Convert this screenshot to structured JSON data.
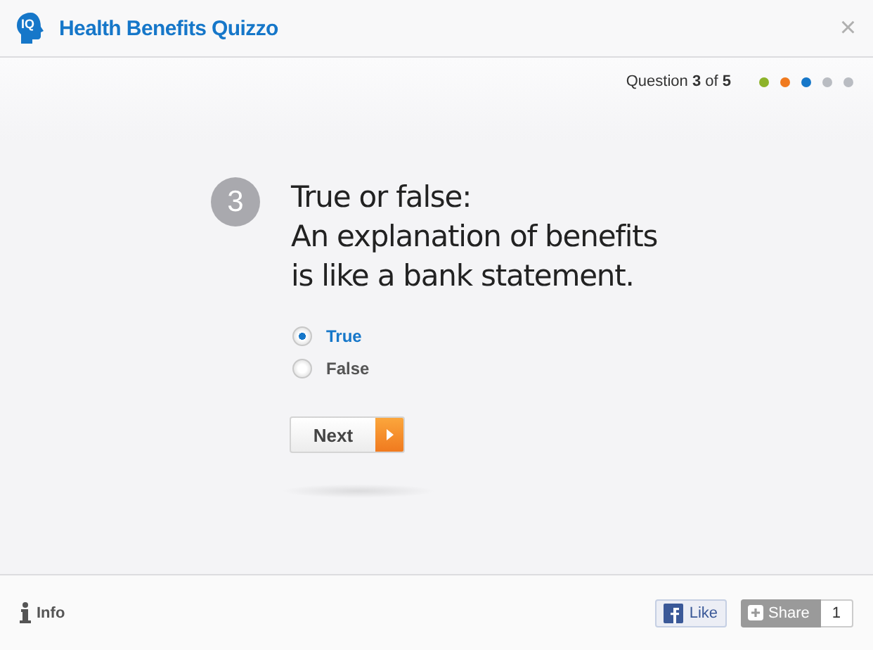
{
  "header": {
    "logo_text": "IQ",
    "title": "Health Benefits Quizzo",
    "close": "×"
  },
  "progress": {
    "text": "Question **3** of **5**",
    "dots": [
      {
        "color": "#8db32a"
      },
      {
        "color": "#f07a1f"
      },
      {
        "color": "#1677c9"
      },
      {
        "color": "#b9bcc2"
      },
      {
        "color": "#b9bcc2"
      }
    ]
  },
  "question": {
    "number": "3",
    "lines": [
      "True or false:",
      "An explanation of benefits",
      "is like a bank statement."
    ]
  },
  "options": [
    {
      "label": "True",
      "selected": true
    },
    {
      "label": "False",
      "selected": false
    }
  ],
  "next_button": "Next",
  "footer": {
    "info": "Info",
    "like": "Like",
    "share": "Share",
    "share_count": "1"
  }
}
